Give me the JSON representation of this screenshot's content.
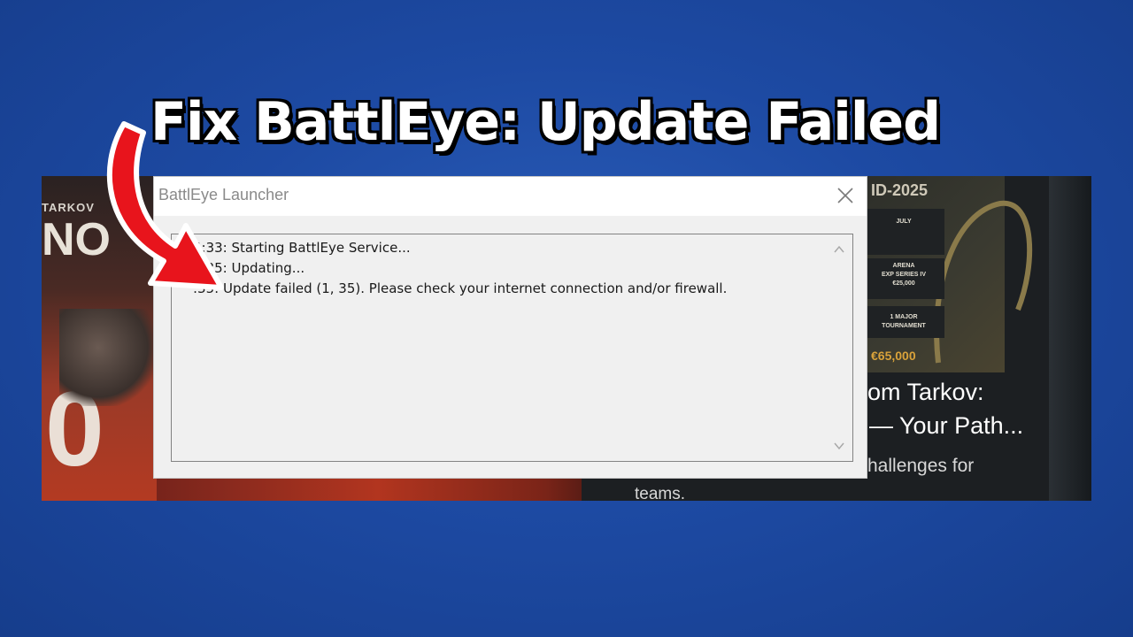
{
  "headline": "Fix BattlEye: Update Failed",
  "background_game": {
    "left_logo_text": "TARKOV",
    "left_logo_big": "NO",
    "left_big_digit": "0",
    "tournament_header": "ID-2025",
    "tournament_cells": [
      "JULY",
      "ARENA\nEXP SERIES IV\n€25,000",
      "1 MAJOR\nTOURNAMENT"
    ],
    "tournament_prize": "€65,000",
    "headline_line1": "om Tarkov:",
    "headline_line2": "— Your Path...",
    "body_line1": "hallenges for",
    "body_line2": "teams."
  },
  "dialog": {
    "title": "BattlEye Launcher",
    "close_icon": "close-icon",
    "log_lines": [
      "4:33: Starting BattlEye Service...",
      "4:35: Updating...",
      ":35: Update failed (1, 35). Please check your internet connection and/or firewall."
    ]
  },
  "colors": {
    "background": "#1d4aa3",
    "arrow": "#e8141c",
    "dialog_bg": "#f0f0f0"
  }
}
